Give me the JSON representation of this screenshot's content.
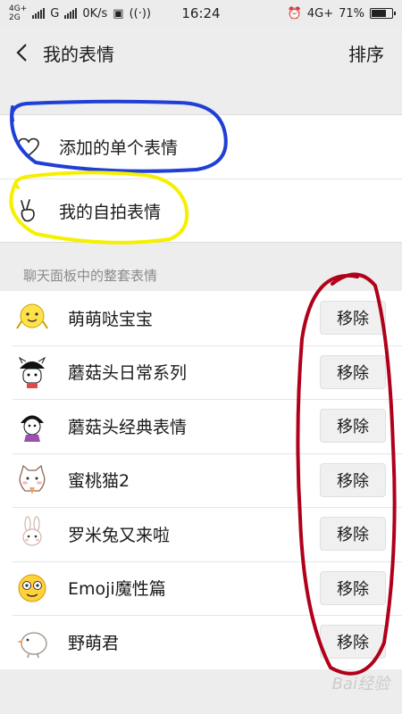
{
  "status_bar": {
    "net_left_top": "4G+",
    "net_left_bottom": "2G",
    "carrier_g": "G",
    "speed": "0K/s",
    "time": "16:24",
    "net_right": "4G+",
    "battery": "71%",
    "battery_level": 0.71
  },
  "nav": {
    "back_icon": "chevron-left-icon",
    "title": "我的表情",
    "sort_label": "排序"
  },
  "group": {
    "items": [
      {
        "icon": "heart-icon",
        "label": "添加的单个表情"
      },
      {
        "icon": "peace-hand-icon",
        "label": "我的自拍表情"
      }
    ]
  },
  "section_title": "聊天面板中的整套表情",
  "packs": [
    {
      "name": "萌萌哒宝宝",
      "icon": "cute-baby-face-icon",
      "button": "移除"
    },
    {
      "name": "蘑菇头日常系列",
      "icon": "mushroom-head-daily-icon",
      "button": "移除"
    },
    {
      "name": "蘑菇头经典表情",
      "icon": "mushroom-head-classic-icon",
      "button": "移除"
    },
    {
      "name": "蜜桃猫2",
      "icon": "peach-cat-icon",
      "button": "移除"
    },
    {
      "name": "罗米兔又来啦",
      "icon": "rabbit-icon",
      "button": "移除"
    },
    {
      "name": "Emoji魔性篇",
      "icon": "emoji-face-icon",
      "button": "移除"
    },
    {
      "name": "野萌君",
      "icon": "bird-icon",
      "button": "移除"
    }
  ],
  "annotation_colors": {
    "blue": "#1f3fd6",
    "yellow": "#f5f000",
    "red": "#b0001a"
  },
  "watermark": "Bai经验"
}
